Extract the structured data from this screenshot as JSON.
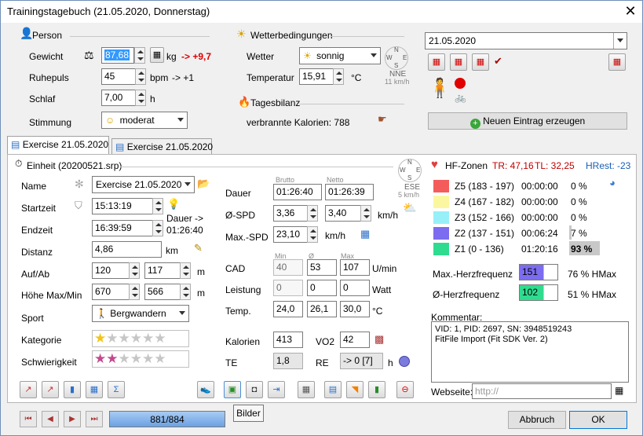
{
  "title": "Trainingstagebuch (21.05.2020, Donnerstag)",
  "person": {
    "header": "Person",
    "weight_label": "Gewicht",
    "weight_value": "87,68",
    "weight_unit": "kg",
    "weight_delta": "-> +9,7",
    "pulse_label": "Ruhepuls",
    "pulse_value": "45",
    "pulse_unit": "bpm",
    "pulse_delta": "-> +1",
    "sleep_label": "Schlaf",
    "sleep_value": "7,00",
    "sleep_unit": "h",
    "mood_label": "Stimmung",
    "mood_value": "moderat"
  },
  "weather": {
    "header": "Wetterbedingungen",
    "weather_label": "Wetter",
    "weather_value": "sonnig",
    "temp_label": "Temperatur",
    "temp_value": "15,91",
    "temp_unit": "°C",
    "wind_dir": "NNE",
    "wind_speed": "11 km/h"
  },
  "daybalance": {
    "header": "Tagesbilanz",
    "calories_text": "verbrannte Kalorien: 788"
  },
  "calendar": {
    "date": "21.05.2020",
    "new_entry_button": "Neuen Eintrag erzeugen"
  },
  "tabs": [
    "Exercise 21.05.2020",
    "Exercise 21.05.2020"
  ],
  "unit": {
    "header": "Einheit (20200521.srp)",
    "name_label": "Name",
    "name_value": "Exercise 21.05.2020",
    "start_label": "Startzeit",
    "start_value": "15:13:19",
    "end_label": "Endzeit",
    "end_value": "16:39:59",
    "duration_hint_1": "Dauer ->",
    "duration_hint_2": "01:26:40",
    "dist_label": "Distanz",
    "dist_value": "4,86",
    "dist_unit": "km",
    "updown_label": "Auf/Ab",
    "up_value": "120",
    "down_value": "117",
    "updown_unit": "m",
    "height_label": "Höhe Max/Min",
    "hmax_value": "670",
    "hmin_value": "566",
    "height_unit": "m",
    "sport_label": "Sport",
    "sport_value": "Bergwandern",
    "category_label": "Kategorie",
    "difficulty_label": "Schwierigkeit",
    "wind_dir": "ESE",
    "wind_speed": "5 km/h"
  },
  "metrics": {
    "brutto": "Brutto",
    "netto": "Netto",
    "duration_label": "Dauer",
    "duration_brutto": "01:26:40",
    "duration_netto": "01:26:39",
    "spd_label": "Ø-SPD",
    "spd_brutto": "3,36",
    "spd_netto": "3,40",
    "spd_unit": "km/h",
    "maxspd_label": "Max.-SPD",
    "maxspd_value": "23,10",
    "maxspd_unit": "km/h",
    "min": "Min",
    "avg": "Ø",
    "max": "Max",
    "cad_label": "CAD",
    "cad_min": "40",
    "cad_avg": "53",
    "cad_max": "107",
    "cad_unit": "U/min",
    "power_label": "Leistung",
    "power_min": "0",
    "power_avg": "0",
    "power_max": "0",
    "power_unit": "Watt",
    "temp_label": "Temp.",
    "temp_min": "24,0",
    "temp_avg": "26,1",
    "temp_max": "30,0",
    "temp_unit": "°C",
    "kcal_label": "Kalorien",
    "kcal_value": "413",
    "vo2_label": "VO2",
    "vo2_value": "42",
    "te_label": "TE",
    "te_value": "1,8",
    "re_label": "RE",
    "re_value": "-> 0 [7]",
    "re_unit": "h"
  },
  "hr": {
    "header": "HF-Zonen",
    "tr": "TR: 47,16",
    "tl": "TL: 32,25",
    "hrest": "HRest: -23",
    "zones": [
      {
        "label": "Z5 (183 - 197)",
        "time": "00:00:00",
        "pct": "0 %",
        "color": "#f45c5c",
        "share": 0
      },
      {
        "label": "Z4 (167 - 182)",
        "time": "00:00:00",
        "pct": "0 %",
        "color": "#fbf7a1",
        "share": 0
      },
      {
        "label": "Z3 (152 - 166)",
        "time": "00:00:00",
        "pct": "0 %",
        "color": "#97f0f7",
        "share": 0
      },
      {
        "label": "Z2 (137 - 151)",
        "time": "00:06:24",
        "pct": "7 %",
        "color": "#7b6cf0",
        "share": 7
      },
      {
        "label": "Z1 (0 - 136)",
        "time": "01:20:16",
        "pct": "93 %",
        "color": "#2fdc8f",
        "share": 93
      }
    ],
    "maxhr_label": "Max.-Herzfrequenz",
    "maxhr_value": "151",
    "maxhr_pct": "76 % HMax",
    "avghr_label": "Ø-Herzfrequenz",
    "avghr_value": "102",
    "avghr_pct": "51 % HMax"
  },
  "comment": {
    "label": "Kommentar:",
    "text_1": "VID: 1, PID: 2697, SN: 3948519243",
    "text_2": "FitFile Import (Fit SDK Ver. 2)",
    "web_label": "Webseite:",
    "web_value": "http://"
  },
  "tooltip": "Bilder",
  "footer": {
    "progress_text": "881/884",
    "progress": 0.997,
    "cancel": "Abbruch",
    "ok": "OK"
  }
}
